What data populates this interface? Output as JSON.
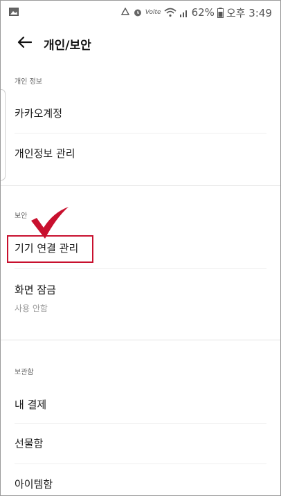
{
  "statusbar": {
    "carrier_mark": "Volte",
    "battery": "62%",
    "time": "오후 3:49"
  },
  "appbar": {
    "title": "개인/보안"
  },
  "sections": {
    "personal": {
      "header": "개인 정보",
      "items": [
        "카카오계정",
        "개인정보 관리"
      ]
    },
    "security": {
      "header": "보안",
      "items": [
        {
          "label": "기기 연결 관리"
        },
        {
          "label": "화면 잠금",
          "sub": "사용 안함"
        }
      ]
    },
    "storage": {
      "header": "보관함",
      "items": [
        "내 결제",
        "선물함",
        "아이템함"
      ]
    }
  },
  "annotation": {
    "highlight_color": "#c8102e"
  }
}
